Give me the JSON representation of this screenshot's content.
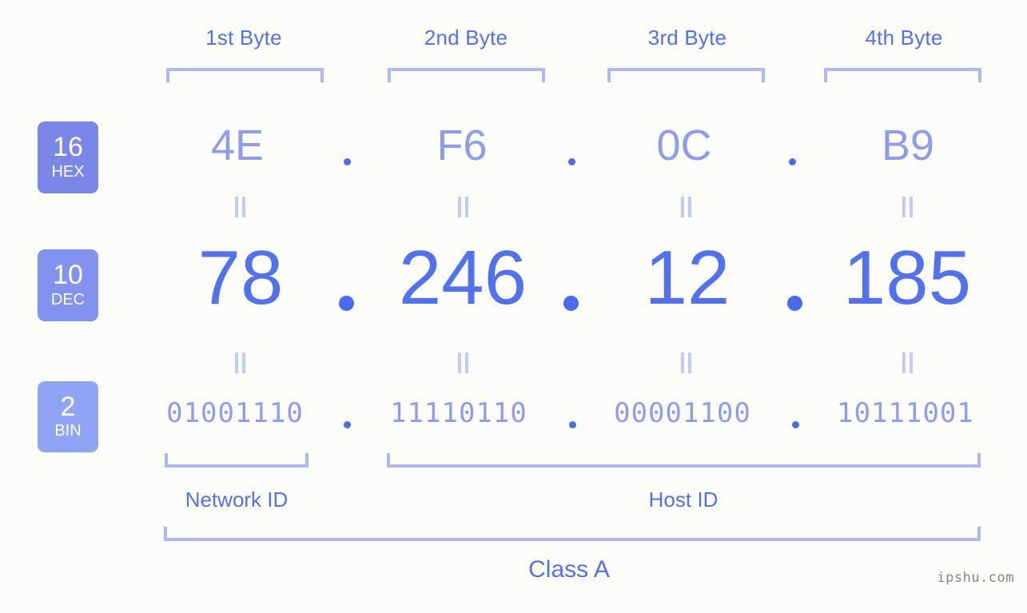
{
  "diagram": {
    "ip_address_decimal": "78.246.12.185",
    "byte_headers": [
      {
        "label": "1st Byte"
      },
      {
        "label": "2nd Byte"
      },
      {
        "label": "3rd Byte"
      },
      {
        "label": "4th Byte"
      }
    ],
    "rows": [
      {
        "badge_number": "16",
        "badge_abbr": "HEX",
        "values": [
          "4E",
          "F6",
          "0C",
          "B9"
        ],
        "separator": "."
      },
      {
        "badge_number": "10",
        "badge_abbr": "DEC",
        "values": [
          "78",
          "246",
          "12",
          "185"
        ],
        "separator": "."
      },
      {
        "badge_number": "2",
        "badge_abbr": "BIN",
        "values": [
          "01001110",
          "11110110",
          "00001100",
          "10111001"
        ],
        "separator": "."
      }
    ],
    "segments": {
      "network_id": "Network ID",
      "host_id": "Host ID",
      "class": "Class A"
    },
    "watermark": "ipshu.com",
    "colors": {
      "background": "#fcfdf9",
      "accent_strong": "#5271f0",
      "accent_mid": "#8e9bf0",
      "accent_light": "#adb8f7",
      "badge_hex": "#7b87e8",
      "badge_dec": "#8293ef",
      "badge_bin": "#8fa4f5",
      "dot": "#4a6af0",
      "watermark": "#7e8490"
    }
  }
}
